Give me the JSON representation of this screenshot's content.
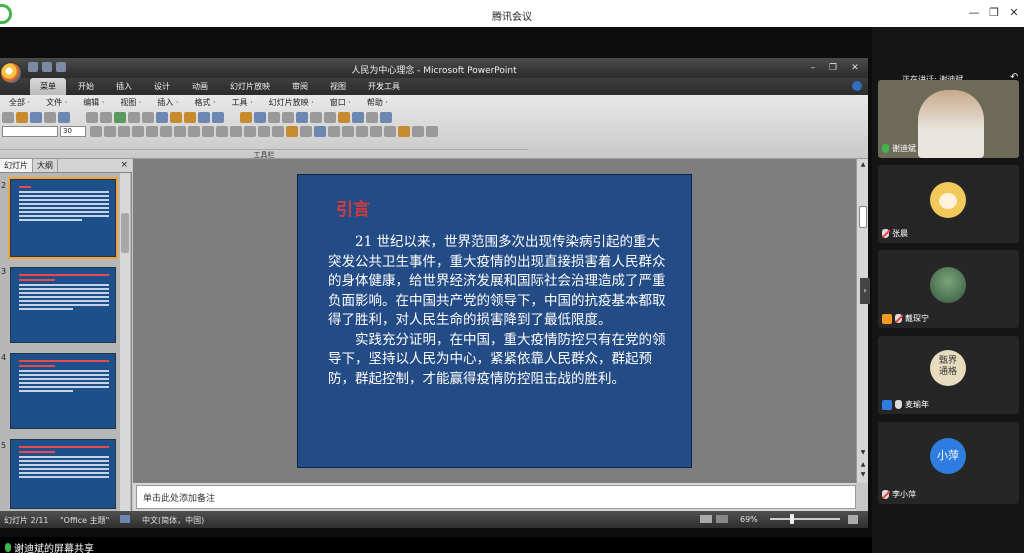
{
  "app": {
    "title": "腾讯会议",
    "window_controls": [
      "minimize-icon",
      "restore-icon",
      "close-icon"
    ],
    "share_label": "谢迪斌的屏幕共享"
  },
  "ppt": {
    "window_title": "人民为中心理念 - Microsoft PowerPoint",
    "tabs": [
      {
        "label": "菜单",
        "active": true
      },
      {
        "label": "开始",
        "active": false
      },
      {
        "label": "插入",
        "active": false
      },
      {
        "label": "设计",
        "active": false
      },
      {
        "label": "动画",
        "active": false
      },
      {
        "label": "幻灯片放映",
        "active": false
      },
      {
        "label": "审阅",
        "active": false
      },
      {
        "label": "视图",
        "active": false
      },
      {
        "label": "开发工具",
        "active": false
      }
    ],
    "menus": [
      "全部 ·",
      "文件 ·",
      "编辑 ·",
      "视图 ·",
      "插入 ·",
      "格式 ·",
      "工具 ·",
      "幻灯片放映 ·",
      "窗口 ·",
      "帮助 ·"
    ],
    "font_size": "30",
    "toolbar_group_label": "工具栏",
    "left_panel": {
      "tabs": [
        "幻灯片",
        "大纲"
      ],
      "close": "×",
      "thumb_numbers": [
        "2",
        "3",
        "4",
        "5"
      ]
    },
    "slide": {
      "title": "引言",
      "paragraph1": "21 世纪以来，世界范围多次出现传染病引起的重大突发公共卫生事件，重大疫情的出现直接损害着人民群众的身体健康，给世界经济发展和国际社会治理造成了严重负面影响。在中国共产党的领导下，中国的抗疫基本都取得了胜利，对人民生命的损害降到了最低限度。",
      "paragraph2": "实践充分证明，在中国，重大疫情防控只有在党的领导下，坚持以人民为中心，紧紧依靠人民群众，群起预防，群起控制，才能赢得疫情防控阻击战的胜利。"
    },
    "notes_placeholder": "单击此处添加备注",
    "status": {
      "slide_counter": "幻灯片 2/11",
      "theme": "\"Office 主题\"",
      "language": "中文(简体，中国)",
      "zoom": "69%"
    }
  },
  "participants": {
    "speaking_label": "正在讲话: 谢迪斌",
    "list": [
      {
        "name": "谢迪斌",
        "avatar_text": ""
      },
      {
        "name": "张晨",
        "avatar_text": ""
      },
      {
        "name": "戴琛宁",
        "avatar_text": ""
      },
      {
        "name": "麦瑜年",
        "avatar_text": "甄界通格"
      },
      {
        "name": "李小萍",
        "avatar_text": "小萍"
      }
    ]
  }
}
